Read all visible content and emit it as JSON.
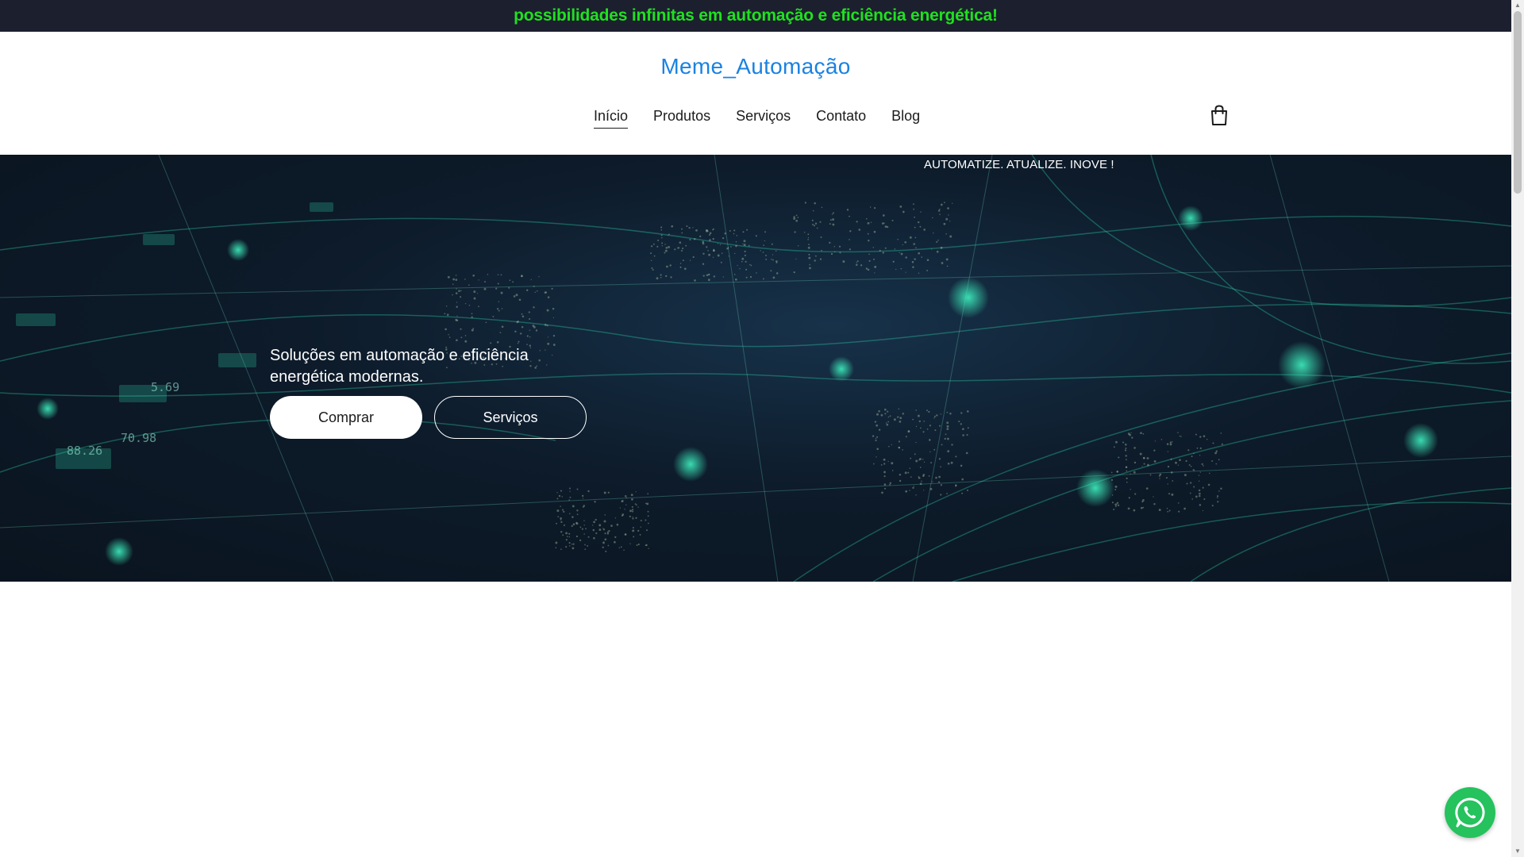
{
  "announcement": {
    "text": "possibilidades infinitas em automação e eficiência energética!"
  },
  "header": {
    "brand": "Meme_Automação",
    "nav": [
      {
        "label": "Início",
        "active": true
      },
      {
        "label": "Produtos"
      },
      {
        "label": "Serviços"
      },
      {
        "label": "Contato"
      },
      {
        "label": "Blog"
      }
    ],
    "cart_icon": "shopping-bag-icon"
  },
  "hero": {
    "tagline": "AUTOMATIZE. ATUALIZE. INOVE !",
    "subtitle": "Soluções em automação e eficiência energética modernas.",
    "buttons": {
      "primary": "Comprar",
      "secondary": "Serviços"
    },
    "background_numbers": [
      "88.26",
      "70.98",
      "5.69"
    ]
  },
  "floating": {
    "whatsapp_icon": "whatsapp-icon"
  },
  "colors": {
    "announcement_bg": "#1c1f2e",
    "announcement_text": "#1fe11f",
    "brand": "#1a82e2",
    "hero_bg": "#0d1b2a",
    "accent_teal": "#3ef0c0",
    "whatsapp": "#25c25d"
  }
}
